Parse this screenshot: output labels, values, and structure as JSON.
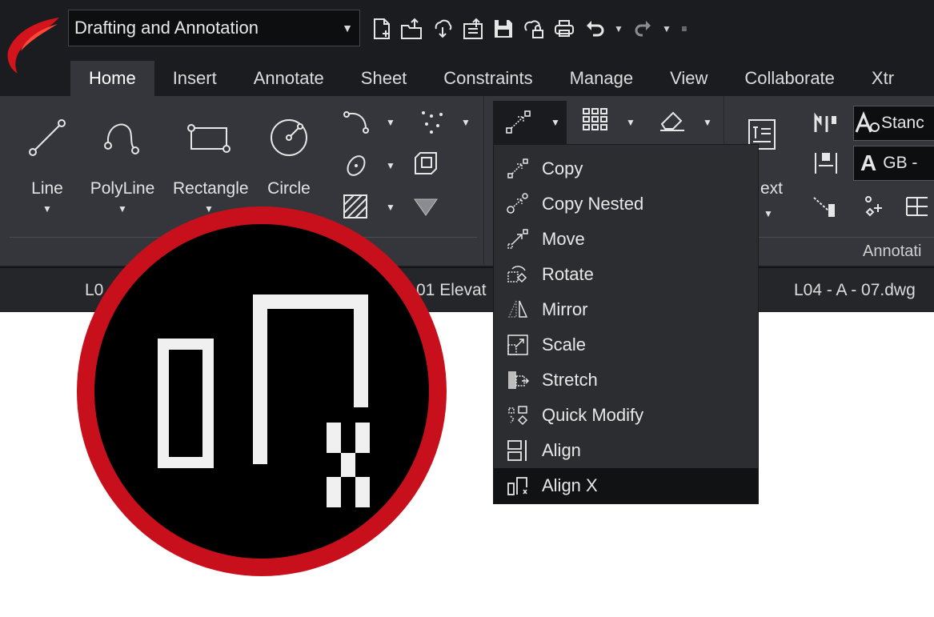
{
  "titlebar": {
    "workspace": "Drafting and Annotation",
    "quick_access": [
      "new-file-icon",
      "open-file-icon",
      "cloud-icon",
      "export-icon",
      "save-icon",
      "cloud-lock-icon",
      "print-icon",
      "undo-icon",
      "redo-icon"
    ]
  },
  "tabs": [
    "Home",
    "Insert",
    "Annotate",
    "Sheet",
    "Constraints",
    "Manage",
    "View",
    "Collaborate",
    "Xtr"
  ],
  "active_tab": "Home",
  "draw_panel": {
    "buttons": [
      {
        "label": "Line",
        "icon": "line-icon"
      },
      {
        "label": "PolyLine",
        "icon": "polyline-icon"
      },
      {
        "label": "Rectangle",
        "icon": "rectangle-icon"
      },
      {
        "label": "Circle",
        "icon": "circle-icon"
      }
    ]
  },
  "annotation_panel": {
    "text_label": "ext",
    "style1": "Stanc",
    "style2": "GB - ",
    "footer": "Annotati"
  },
  "file_tabs": [
    "L0",
    "01 Elevat",
    "L04 - A - 07.dwg"
  ],
  "modify_menu": {
    "items": [
      {
        "label": "Copy",
        "icon": "copy-icon"
      },
      {
        "label": "Copy Nested",
        "icon": "copy-nested-icon"
      },
      {
        "label": "Move",
        "icon": "move-icon"
      },
      {
        "label": "Rotate",
        "icon": "rotate-icon"
      },
      {
        "label": "Mirror",
        "icon": "mirror-icon"
      },
      {
        "label": "Scale",
        "icon": "scale-icon"
      },
      {
        "label": "Stretch",
        "icon": "stretch-icon"
      },
      {
        "label": "Quick Modify",
        "icon": "quick-modify-icon"
      },
      {
        "label": "Align",
        "icon": "align-icon"
      },
      {
        "label": "Align X",
        "icon": "align-x-icon"
      }
    ],
    "selected": "Align X"
  },
  "magnified_icon": "align-x-icon",
  "colors": {
    "accent_red": "#c8101c",
    "ribbon": "#34363b",
    "background": "#1b1c1f"
  }
}
